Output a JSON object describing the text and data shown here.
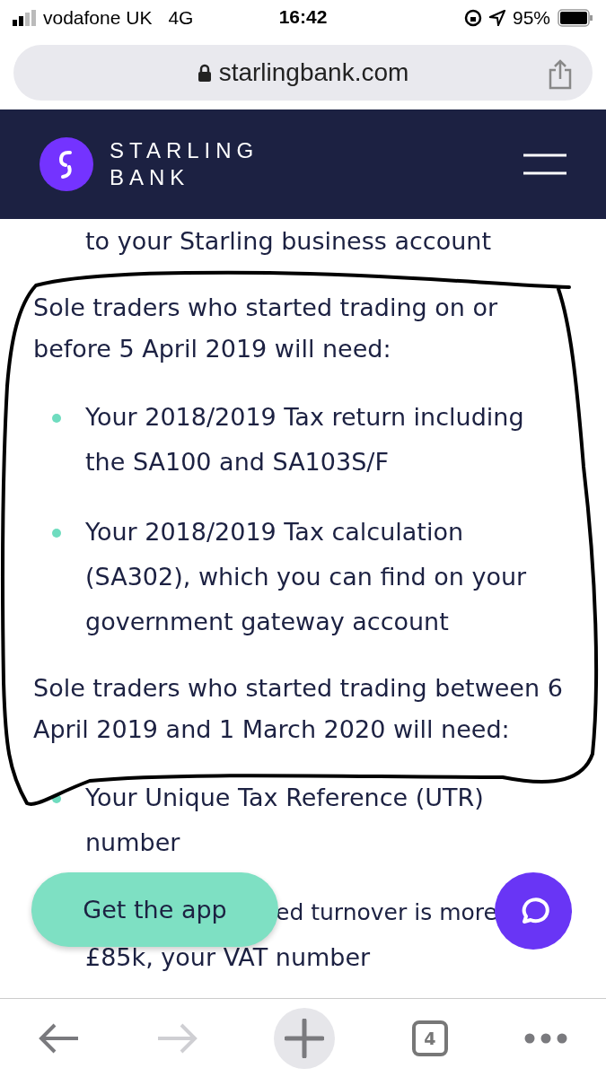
{
  "status_bar": {
    "carrier": "vodafone UK",
    "network": "4G",
    "time": "16:42",
    "battery": "95%"
  },
  "address_bar": {
    "url": "starlingbank.com"
  },
  "header": {
    "logo_lines": [
      "STARLING",
      "BANK"
    ]
  },
  "content": [
    {
      "kind": "continuation",
      "text": "to your Starling business account"
    },
    {
      "kind": "paragraph",
      "text": "Sole traders who started trading on or before 5 April 2019 will need:"
    },
    {
      "kind": "bullet",
      "text": "Your 2018/2019 Tax return including the SA100 and SA103S/F"
    },
    {
      "kind": "bullet",
      "text": "Your 2018/2019 Tax calculation (SA302), which you can find on your government gateway account"
    },
    {
      "kind": "paragraph",
      "text": "Sole traders who started trading between 6 April 2019 and 1 March 2020 will need:"
    },
    {
      "kind": "bullet",
      "text": "Your Unique Tax Reference (UTR) number"
    },
    {
      "kind": "covered",
      "lines": [
        "ed turnover is more",
        "£85k, your VAT number"
      ]
    }
  ],
  "get_app_button": {
    "label": "Get the app"
  },
  "toolbar": {
    "tab_count": "4",
    "forward_disabled": true
  }
}
